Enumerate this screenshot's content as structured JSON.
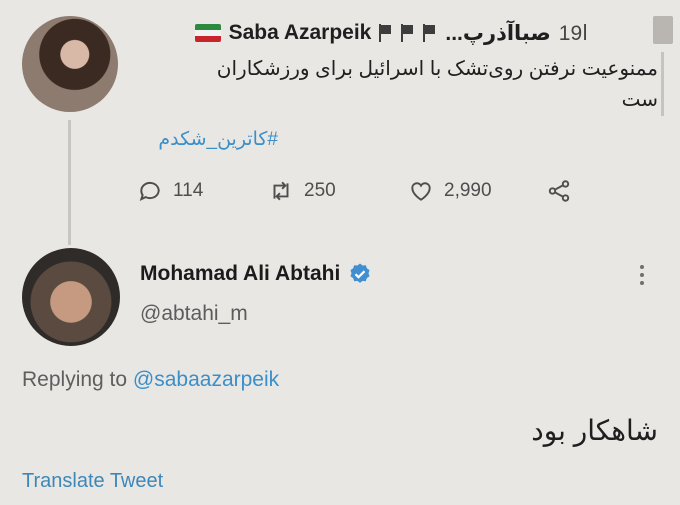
{
  "tweet1": {
    "display_name": "Saba Azarpeik",
    "persian_name": "صباآذرپ...",
    "rank": "19ا",
    "body_line1": "ممنوعیت نرفتن روی‌تشک با اسرائیل برای ورزشکاران",
    "body_line2": "ست",
    "hashtag": "#کاترین_شکدم",
    "stats": {
      "replies": "114",
      "retweets": "250",
      "likes": "2,990"
    }
  },
  "tweet2": {
    "display_name": "Mohamad Ali Abtahi",
    "handle": "@abtahi_m",
    "replying_prefix": "Replying to",
    "replying_to": "@sabaazarpeik",
    "body": "شاهکار بود",
    "translate_label": "Translate Tweet"
  },
  "colors": {
    "background": "#e9e7e4",
    "link": "#3a8fc9",
    "verified": "#3f8fd1"
  },
  "icons": [
    "reply-icon",
    "retweet-icon",
    "like-icon",
    "share-icon",
    "verified-icon",
    "more-icon",
    "iran-flag-icon",
    "pennant-icon"
  ]
}
